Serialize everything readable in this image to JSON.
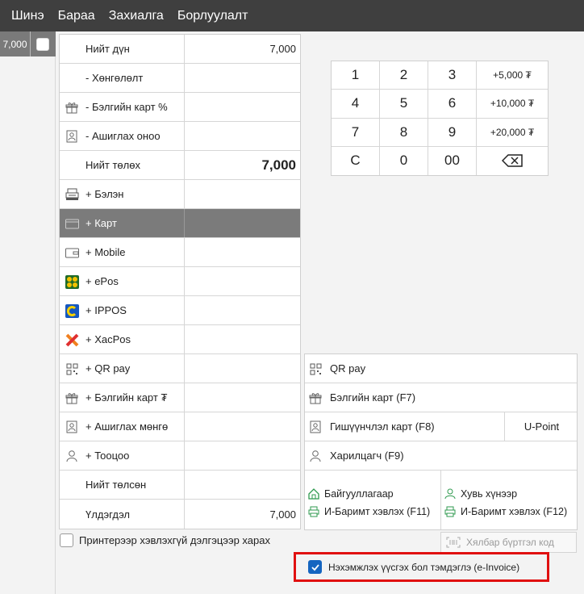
{
  "menu": [
    "Шинэ",
    "Бараа",
    "Захиалга",
    "Борлуулалт"
  ],
  "order_tab": {
    "amount": "7,000"
  },
  "pay_rows": [
    {
      "label": "Нийт дүн",
      "value": "7,000",
      "icon": ""
    },
    {
      "label": "- Хөнгөлөлт",
      "value": "",
      "icon": ""
    },
    {
      "label": "- Бэлгийн карт %",
      "value": "",
      "icon": "gift-icon"
    },
    {
      "label": "- Ашиглах оноо",
      "value": "",
      "icon": "member-card-icon"
    },
    {
      "label": "Нийт төлөх",
      "value": "7,000",
      "icon": ""
    },
    {
      "label": "+ Бэлэн",
      "value": "",
      "icon": "cash-register-icon"
    },
    {
      "label": "+ Карт",
      "value": "",
      "icon": "card-icon"
    },
    {
      "label": "+ Mobile",
      "value": "",
      "icon": "wallet-icon"
    },
    {
      "label": "+ ePos",
      "value": "",
      "icon": "epos-icon"
    },
    {
      "label": "+ IPPOS",
      "value": "",
      "icon": "ippos-icon"
    },
    {
      "label": "+ XacPos",
      "value": "",
      "icon": "xacpos-icon"
    },
    {
      "label": "+ QR pay",
      "value": "",
      "icon": "qr-icon"
    },
    {
      "label": "+ Бэлгийн карт ₮",
      "value": "",
      "icon": "gift-icon"
    },
    {
      "label": "+ Ашиглах мөнгө",
      "value": "",
      "icon": "member-card-icon"
    },
    {
      "label": "+ Тооцоо",
      "value": "",
      "icon": "person-icon"
    },
    {
      "label": "Нийт төлсөн",
      "value": "",
      "icon": ""
    },
    {
      "label": "Үлдэгдэл",
      "value": "7,000",
      "icon": ""
    }
  ],
  "keypad": [
    [
      "1",
      "2",
      "3",
      "+5,000 ₮"
    ],
    [
      "4",
      "5",
      "6",
      "+10,000 ₮"
    ],
    [
      "7",
      "8",
      "9",
      "+20,000 ₮"
    ],
    [
      "C",
      "0",
      "00",
      ""
    ]
  ],
  "options": {
    "qr_pay": "QR pay",
    "gift_card": "Бэлгийн карт (F7)",
    "member_card": "Гишүүнчлэл карт (F8)",
    "upoint": "U-Point",
    "customer": "Харилцагч (F9)",
    "org_title": "Байгууллагаар",
    "org_print": "И-Баримт хэвлэх (F11)",
    "person_title": "Хувь хүнээр",
    "person_print": "И-Баримт хэвлэх (F12)"
  },
  "print_preview": {
    "label": "Принтерээр хэвлэхгүй дэлгэцээр харах",
    "checked": false
  },
  "easy_code": {
    "placeholder": "Хялбар бүртгэл код"
  },
  "einvoice": {
    "label": "Нэхэмжлэх үүсгэх бол тэмдэглэ (e-Invoice)",
    "checked": true
  },
  "colors": {
    "menubar": "#3f3f3f",
    "selected_row": "#7b7b7b",
    "highlight_border": "#e01010",
    "checkbox": "#1565c0"
  }
}
